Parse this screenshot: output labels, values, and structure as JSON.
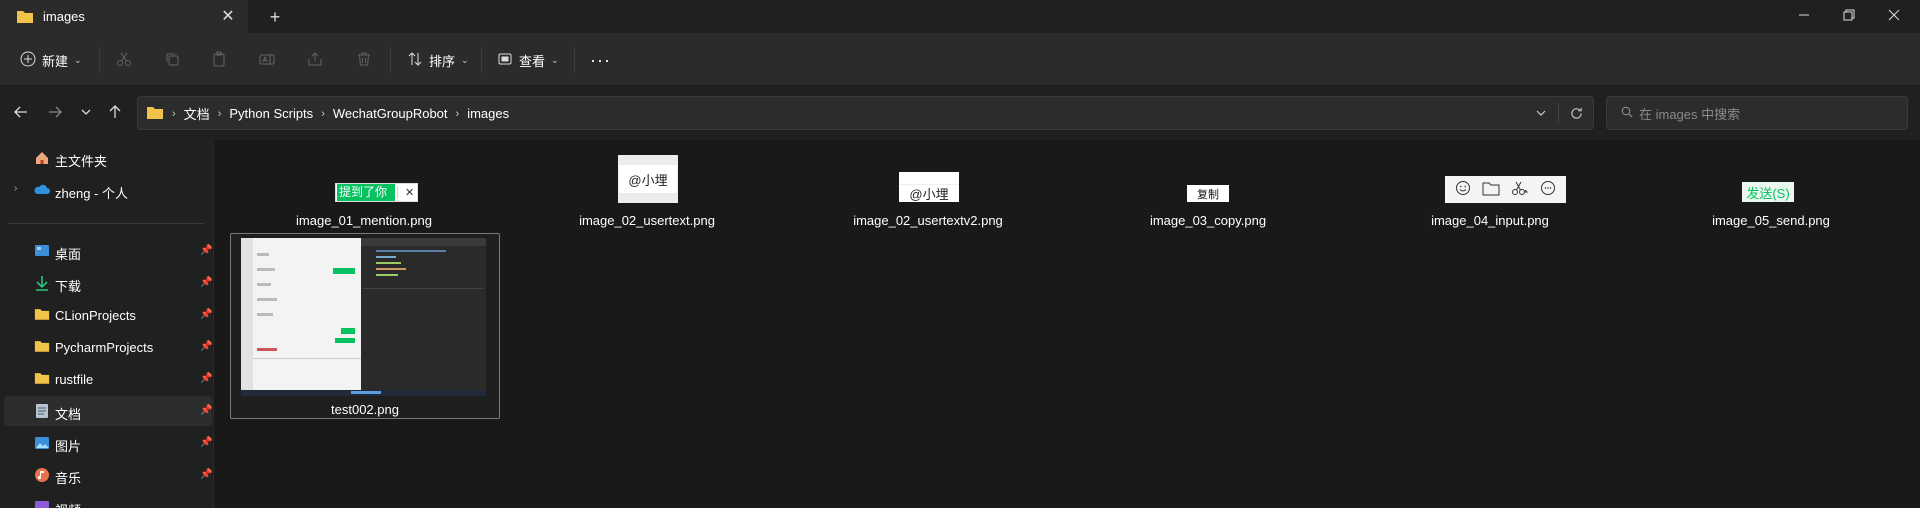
{
  "tab": {
    "title": "images",
    "close_symbol": "✕",
    "new_symbol": "+"
  },
  "window": {
    "minimize": "—",
    "maximize": "❐",
    "close": "✕"
  },
  "toolbar": {
    "new_label": "新建",
    "sort_label": "排序",
    "view_label": "查看",
    "more_label": "···"
  },
  "address": {
    "crumbs": [
      "文档",
      "Python Scripts",
      "WechatGroupRobot",
      "images"
    ]
  },
  "search": {
    "placeholder": "在 images 中搜索"
  },
  "sidebar": {
    "items": [
      {
        "label": "主文件夹",
        "icon": "home-icon"
      },
      {
        "label": "zheng - 个人",
        "icon": "onedrive-cloud-icon"
      },
      {
        "label": "桌面",
        "icon": "desktop-icon"
      },
      {
        "label": "下载",
        "icon": "download-icon"
      },
      {
        "label": "CLionProjects",
        "icon": "folder-icon"
      },
      {
        "label": "PycharmProjects",
        "icon": "folder-icon"
      },
      {
        "label": "rustfile",
        "icon": "folder-icon"
      },
      {
        "label": "文档",
        "icon": "documents-icon"
      },
      {
        "label": "图片",
        "icon": "pictures-icon"
      },
      {
        "label": "音乐",
        "icon": "music-icon"
      },
      {
        "label": "视频",
        "icon": "videos-icon"
      }
    ]
  },
  "files": [
    {
      "name": "image_01_mention.png",
      "thumb_text": "提到了你",
      "thumb_close": "✕"
    },
    {
      "name": "image_02_usertext.png",
      "thumb_text": "@小埋"
    },
    {
      "name": "image_02_usertextv2.png",
      "thumb_text": "@小埋"
    },
    {
      "name": "image_03_copy.png",
      "thumb_text": "复制"
    },
    {
      "name": "image_04_input.png",
      "thumb_text": ""
    },
    {
      "name": "image_05_send.png",
      "thumb_text": "发送(S)"
    },
    {
      "name": "test002.png",
      "thumb_text": ""
    }
  ],
  "colors": {
    "accent_green": "#07c160",
    "folder_yellow": "#f2c34b",
    "onedrive_blue": "#2f8fe0"
  }
}
